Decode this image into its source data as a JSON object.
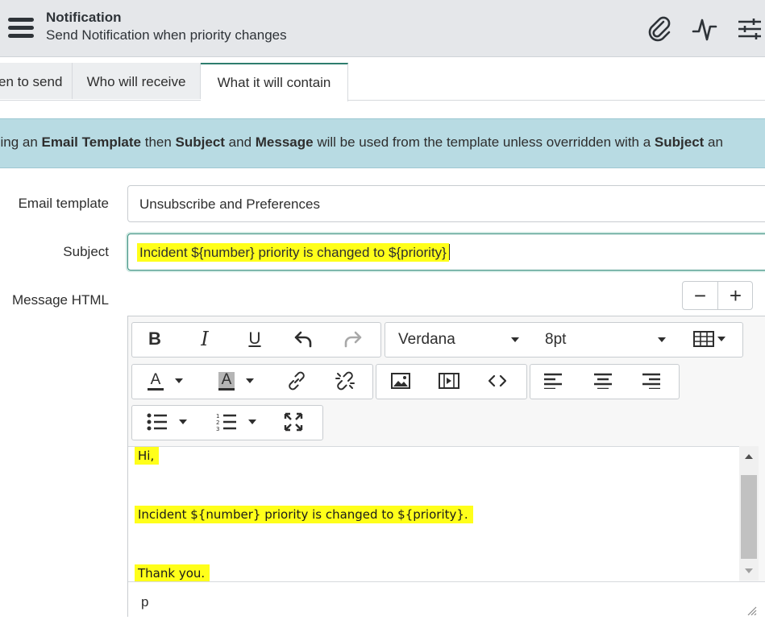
{
  "header": {
    "title": "Notification",
    "subtitle": "Send Notification when priority changes",
    "icons": [
      "menu-icon",
      "paperclip-icon",
      "activity-icon",
      "settings-sliders-icon"
    ]
  },
  "tabs": [
    {
      "label": "en to send",
      "active": false
    },
    {
      "label": "Who will receive",
      "active": false
    },
    {
      "label": "What it will contain",
      "active": true
    }
  ],
  "banner": {
    "p1": "sing an ",
    "b1": "Email Template",
    "p2": " then ",
    "b2": "Subject",
    "p3": " and ",
    "b3": "Message",
    "p4": " will be used from the template unless overridden with a ",
    "b4": "Subject",
    "p5": " an"
  },
  "form": {
    "email_template_label": "Email template",
    "email_template_value": "Unsubscribe and Preferences",
    "subject_label": "Subject",
    "subject_value": "Incident ${number} priority is changed to ${priority}",
    "message_label": "Message HTML"
  },
  "zoom": {
    "minus": "−",
    "plus": "+"
  },
  "editor": {
    "font_family": "Verdana",
    "font_size": "8pt",
    "content": {
      "line1": "Hi,",
      "line2": "Incident ${number} priority is changed to ${priority}.",
      "line3": "Thank you."
    },
    "status_path": "p"
  },
  "colors": {
    "header_bg": "#e5e7ea",
    "banner_bg": "#b8dbe3",
    "accent": "#2e7d6e",
    "highlight": "#ffff1a"
  }
}
